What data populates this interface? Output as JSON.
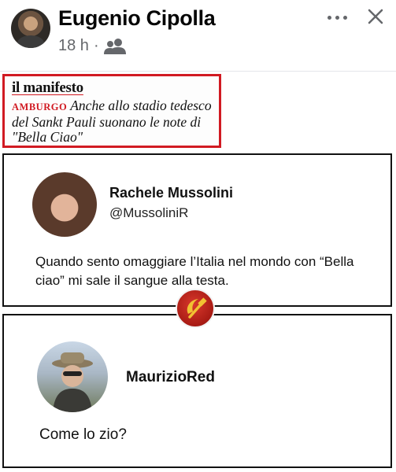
{
  "post": {
    "author": "Eugenio Cipolla",
    "time": "18 h",
    "separator": "·",
    "audience_icon": "friends-icon",
    "more_icon": "more-dots-icon",
    "close_icon": "close-icon"
  },
  "meme": {
    "newspaper": {
      "name": "il manifesto",
      "kicker": "AMBURGO",
      "headline": "Anche allo stadio tedesco del Sankt Pauli suonano le note di \"Bella Ciao\"",
      "border_color": "#d11a22"
    },
    "tweet1": {
      "name": "Rachele Mussolini",
      "handle": "@MussoliniR",
      "text": "Quando sento omaggiare l’Italia nel mondo con “Bella ciao” mi sale il sangue alla testa."
    },
    "emblem_icon": "hammer-sickle-icon",
    "tweet2": {
      "name": "MaurizioRed",
      "text": "Come lo zio?"
    }
  }
}
